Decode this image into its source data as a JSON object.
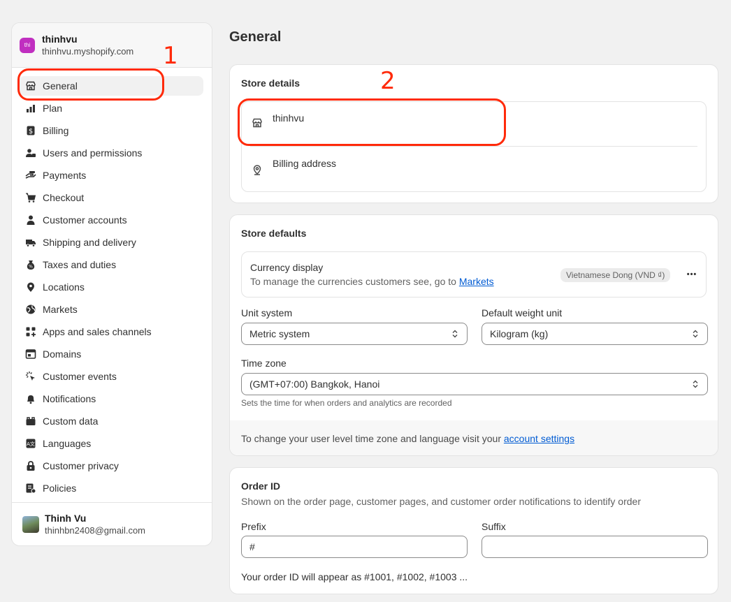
{
  "store": {
    "initials": "thi",
    "name": "thinhvu",
    "url": "thinhvu.myshopify.com"
  },
  "nav": [
    {
      "label": "General",
      "icon": "store-icon",
      "active": true
    },
    {
      "label": "Plan",
      "icon": "plan-chart-icon"
    },
    {
      "label": "Billing",
      "icon": "billing-dollar-icon"
    },
    {
      "label": "Users and permissions",
      "icon": "users-icon"
    },
    {
      "label": "Payments",
      "icon": "payments-hand-icon"
    },
    {
      "label": "Checkout",
      "icon": "cart-icon"
    },
    {
      "label": "Customer accounts",
      "icon": "person-icon"
    },
    {
      "label": "Shipping and delivery",
      "icon": "truck-icon"
    },
    {
      "label": "Taxes and duties",
      "icon": "tax-bag-icon"
    },
    {
      "label": "Locations",
      "icon": "location-pin-icon"
    },
    {
      "label": "Markets",
      "icon": "globe-icon"
    },
    {
      "label": "Apps and sales channels",
      "icon": "apps-grid-icon"
    },
    {
      "label": "Domains",
      "icon": "domains-icon"
    },
    {
      "label": "Customer events",
      "icon": "cursor-click-icon"
    },
    {
      "label": "Notifications",
      "icon": "bell-icon"
    },
    {
      "label": "Custom data",
      "icon": "database-icon"
    },
    {
      "label": "Languages",
      "icon": "language-icon"
    },
    {
      "label": "Customer privacy",
      "icon": "lock-icon"
    },
    {
      "label": "Policies",
      "icon": "policies-icon"
    }
  ],
  "user": {
    "name": "Thinh Vu",
    "email": "thinhbn2408@gmail.com"
  },
  "page": {
    "title": "General"
  },
  "store_details": {
    "title": "Store details",
    "store_row": "thinhvu",
    "billing_row": "Billing address"
  },
  "store_defaults": {
    "title": "Store defaults",
    "currency_label": "Currency display",
    "currency_help_prefix": "To manage the currencies customers see, go to ",
    "currency_help_link": "Markets",
    "currency_badge": "Vietnamese Dong (VND ₫)",
    "more_label": "•••",
    "unit_system_label": "Unit system",
    "unit_system_value": "Metric system",
    "weight_unit_label": "Default weight unit",
    "weight_unit_value": "Kilogram (kg)",
    "timezone_label": "Time zone",
    "timezone_value": "(GMT+07:00) Bangkok, Hanoi",
    "timezone_help": "Sets the time for when orders and analytics are recorded",
    "footer_prefix": "To change your user level time zone and language visit your ",
    "footer_link": "account settings"
  },
  "order_id": {
    "title": "Order ID",
    "subtitle": "Shown on the order page, customer pages, and customer order notifications to identify order",
    "prefix_label": "Prefix",
    "prefix_value": "#",
    "suffix_label": "Suffix",
    "suffix_value": "",
    "preview": "Your order ID will appear as #1001, #1002, #1003 ..."
  },
  "annotations": {
    "one": "1",
    "two": "2",
    "color": "#ff2a0a"
  }
}
